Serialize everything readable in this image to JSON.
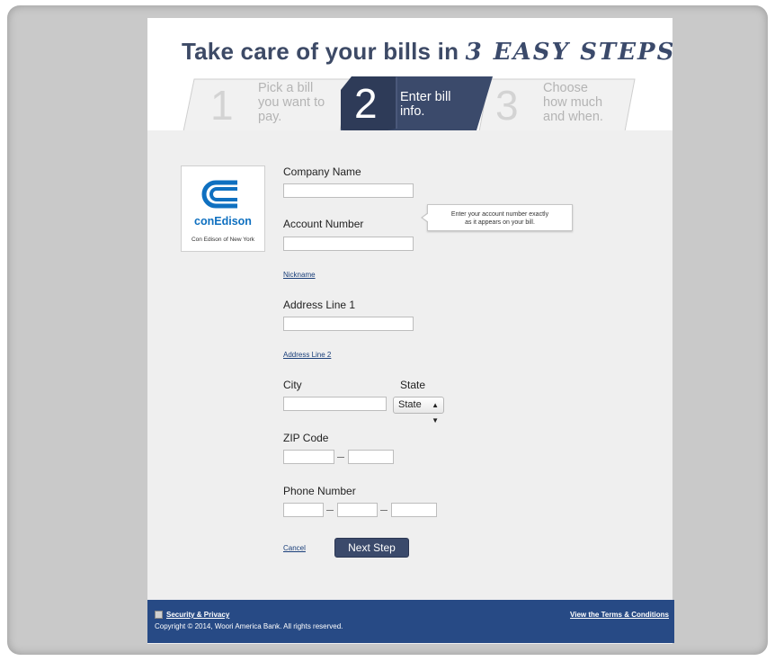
{
  "headline": {
    "text": "Take care of your bills in",
    "hand": "3 EASY STEPS."
  },
  "steps": [
    {
      "number": "1",
      "line1": "Pick a bill",
      "line2": "you want to",
      "line3": "pay.",
      "state": "inactive"
    },
    {
      "number": "2",
      "line1": "Enter bill",
      "line2": "info.",
      "line3": "",
      "state": "active"
    },
    {
      "number": "3",
      "line1": "Choose",
      "line2": "how much",
      "line3": "and when.",
      "state": "inactive"
    }
  ],
  "biller": {
    "name": "conEdison",
    "subtitle": "Con Edison of New York",
    "brand_color": "#0f70c0"
  },
  "form": {
    "company_label": "Company Name",
    "company_value": "",
    "account_label": "Account Number",
    "account_value": "",
    "account_tooltip_line1": "Enter your account number exactly",
    "account_tooltip_line2": "as it appears on your bill.",
    "nickname_link": "Nickname",
    "address1_label": "Address Line 1",
    "address1_value": "",
    "address2_link": "Address Line 2",
    "city_label": "City",
    "city_value": "",
    "state_label": "State",
    "state_selected": "State",
    "zip_label": "ZIP Code",
    "zip_value_1": "",
    "zip_value_2": "",
    "phone_label": "Phone Number",
    "phone_value_1": "",
    "phone_value_2": "",
    "phone_value_3": "",
    "cancel_link": "Cancel",
    "next_button": "Next Step"
  },
  "footer": {
    "security_link": "Security & Privacy",
    "copyright": "Copyright © 2014, Woori America Bank. All rights reserved.",
    "terms_link": "View the Terms & Conditions"
  },
  "colors": {
    "accent": "#3b4a6b",
    "footer": "#274a85",
    "background": "#efefef"
  },
  "icons": {
    "biller_logo": "conedison-logo-icon",
    "security": "lock-icon",
    "select": "chevron-updown-icon"
  }
}
